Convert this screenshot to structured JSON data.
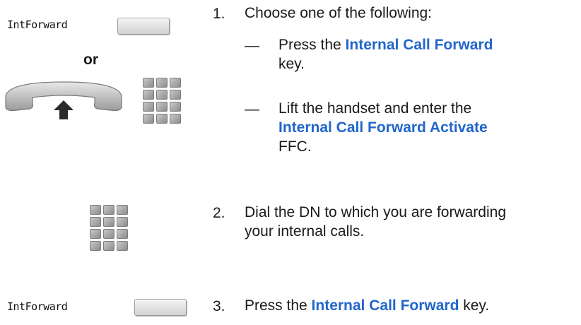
{
  "steps": [
    {
      "number": "1.",
      "softkey_label": "IntForward",
      "or_label": "or",
      "text": "Choose one of the following:",
      "options": [
        {
          "dash": "—",
          "before": "Press the ",
          "highlight": "Internal Call Forward",
          "after": "key."
        },
        {
          "dash": "—",
          "before": "Lift the handset and enter the",
          "highlight": "Internal Call Forward Activate",
          "after": "FFC."
        }
      ]
    },
    {
      "number": "2.",
      "line1": "Dial the DN to which you are forwarding",
      "line2": "your internal calls."
    },
    {
      "number": "3.",
      "softkey_label": "IntForward",
      "before": "Press the ",
      "highlight": "Internal Call Forward",
      "after": " key."
    }
  ],
  "icons": [
    "softkey-button-icon",
    "handset-lift-icon",
    "keypad-icon"
  ],
  "colors": {
    "highlight": "#2266cc"
  }
}
